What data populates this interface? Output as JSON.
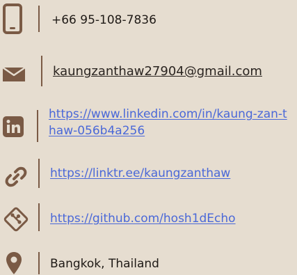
{
  "contact": {
    "phone": "+66 95-108-7836",
    "email": "kaungzanthaw27904@gmail.com",
    "linkedin": "https://www.linkedin.com/in/kaung-zan-thaw-056b4a256",
    "linktree": "https://linktr.ee/kaungzanthaw",
    "github": "https://github.com/hosh1dEcho",
    "location": "Bangkok, Thailand"
  },
  "icons": {
    "phone": "phone-icon",
    "email": "envelope-icon",
    "linkedin": "linkedin-icon",
    "linktree": "link-icon",
    "github": "git-icon",
    "location": "map-pin-icon"
  },
  "colors": {
    "background": "#e6ddd0",
    "icon": "#7a5a45",
    "link": "#4a68d8",
    "text": "#1f1a16"
  }
}
